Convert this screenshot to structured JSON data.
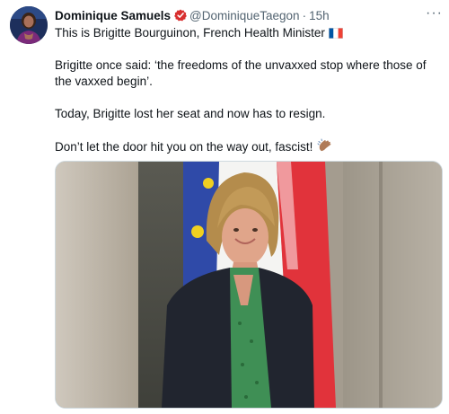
{
  "tweet": {
    "author_name": "Dominique Samuels",
    "handle": "@DominiqueTaegon",
    "separator": "·",
    "time": "15h",
    "more_label": "···",
    "paragraphs": [
      "This is Brigitte Bourguinon, French Health Minister",
      "Brigitte once said: ‘the freedoms of the unvaxxed stop where those of the vaxxed begin’.",
      "Today, Brigitte lost her seat and now has to resign.",
      "Don’t let the door hit you on the way out, fascist!"
    ],
    "icons": {
      "verified": "verified-badge-icon",
      "flag": "france-flag-icon",
      "emoji": "waving-hand-icon",
      "more": "more-options-icon"
    }
  },
  "colors": {
    "text": "#0f1419",
    "secondary": "#536471",
    "verified_badge": "#d82f2f",
    "flag_blue": "#0055a4",
    "flag_red": "#ef4135"
  }
}
